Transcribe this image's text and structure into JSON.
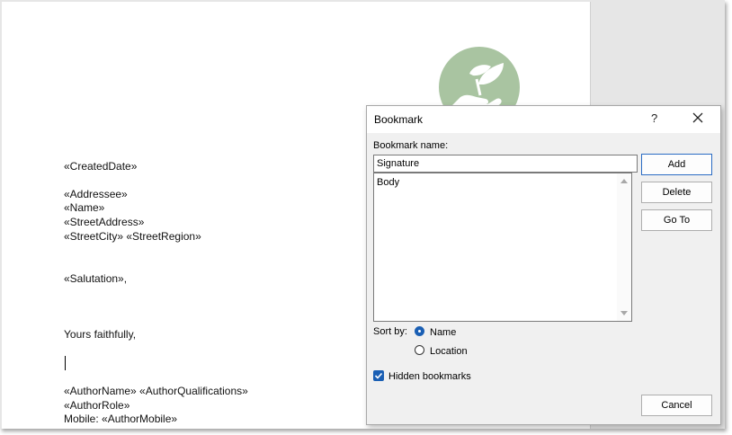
{
  "document": {
    "lines": [
      "«CreatedDate»",
      "«Addressee»",
      "«Name»",
      "«StreetAddress»",
      "«StreetCity» «StreetRegion»",
      "«Salutation»,",
      "Yours faithfully,",
      "«AuthorName» «AuthorQualifications»",
      "«AuthorRole»",
      "Mobile: «AuthorMobile»"
    ],
    "logo_icon": "plant-in-hand-icon",
    "logo_color": "#a9c4a1"
  },
  "dialog": {
    "title": "Bookmark",
    "help": "?",
    "bookmark_name_label": "Bookmark name:",
    "bookmark_name_value": "Signature",
    "list_items": [
      "Body"
    ],
    "buttons": {
      "add": "Add",
      "delete": "Delete",
      "go_to": "Go To",
      "cancel": "Cancel"
    },
    "sort_by_label": "Sort by:",
    "sort_options": [
      "Name",
      "Location"
    ],
    "sort_selected": "Name",
    "hidden_bookmarks_label": "Hidden bookmarks",
    "hidden_bookmarks_checked": true,
    "accent_color": "#1a5fb4"
  }
}
